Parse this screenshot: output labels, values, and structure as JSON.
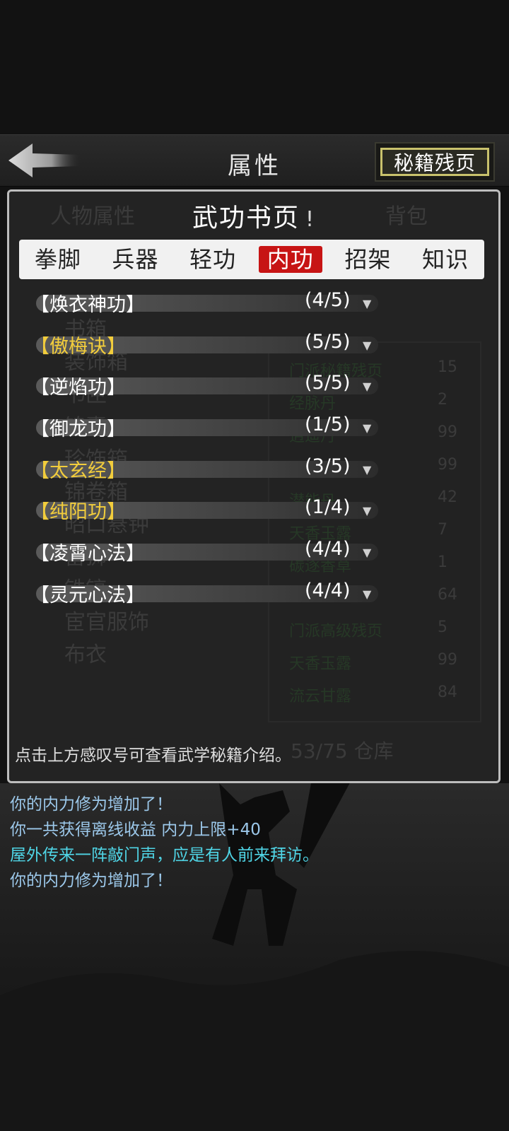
{
  "header": {
    "title": "属性",
    "book_button_label": "秘籍残页"
  },
  "panel": {
    "title": "武功书页",
    "title_mark": "!",
    "tabs": [
      {
        "label": "拳脚",
        "active": false
      },
      {
        "label": "兵器",
        "active": false
      },
      {
        "label": "轻功",
        "active": false
      },
      {
        "label": "内功",
        "active": true
      },
      {
        "label": "招架",
        "active": false
      },
      {
        "label": "知识",
        "active": false
      }
    ],
    "skills": [
      {
        "name": "【焕衣神功】",
        "progress": "(4/5)",
        "highlight": false
      },
      {
        "name": "【傲梅诀】",
        "progress": "(5/5)",
        "highlight": true
      },
      {
        "name": "【逆焰功】",
        "progress": "(5/5)",
        "highlight": false
      },
      {
        "name": "【御龙功】",
        "progress": "(1/5)",
        "highlight": false
      },
      {
        "name": "【太玄经】",
        "progress": "(3/5)",
        "highlight": true
      },
      {
        "name": "【纯阳功】",
        "progress": "(1/4)",
        "highlight": true
      },
      {
        "name": "【凌霄心法】",
        "progress": "(4/4)",
        "highlight": false
      },
      {
        "name": "【灵元心法】",
        "progress": "(4/4)",
        "highlight": false
      }
    ],
    "hint": "点击上方感叹号可查看武学秘籍介绍。"
  },
  "background_faded": {
    "tab_left": "人物属性",
    "tab_right": "背包",
    "left_items": [
      "书箱",
      "装饰箱",
      "书匣",
      "锦囊",
      "珍饰箱",
      "锦卷箱",
      "昭口悬钟",
      "雷狮",
      "铁镐",
      "宦官服饰",
      "布衣"
    ],
    "right_items": [
      {
        "name": "门派秘籍残页",
        "count": "15"
      },
      {
        "name": "经脉丹",
        "count": "2"
      },
      {
        "name": "逍遥丹",
        "count": "99"
      },
      {
        "name": "",
        "count": "99"
      },
      {
        "name": "潜能丹",
        "count": "42"
      },
      {
        "name": "天香玉露",
        "count": "7"
      },
      {
        "name": "碳逐香草",
        "count": "1"
      },
      {
        "name": "",
        "count": "64"
      },
      {
        "name": "门派高级残页",
        "count": "5"
      },
      {
        "name": "天香玉露",
        "count": "99"
      },
      {
        "name": "流云甘露",
        "count": "84"
      }
    ],
    "capacity": "53/75 仓库"
  },
  "log": [
    {
      "text": "你的内力修为增加了！",
      "color": "blue"
    },
    {
      "text": "你一共获得离线收益 内力上限+40",
      "color": "blue"
    },
    {
      "text": "屋外传来一阵敲门声，应是有人前来拜访。",
      "color": "cyan"
    },
    {
      "text": "你的内力修为增加了！",
      "color": "blue"
    }
  ],
  "colors": {
    "active_tab": "#c71414",
    "highlight_skill": "#f2cd3c",
    "book_button_border": "#c9c26c",
    "log_blue": "#9cc8ea",
    "log_cyan": "#4fd5e6"
  }
}
